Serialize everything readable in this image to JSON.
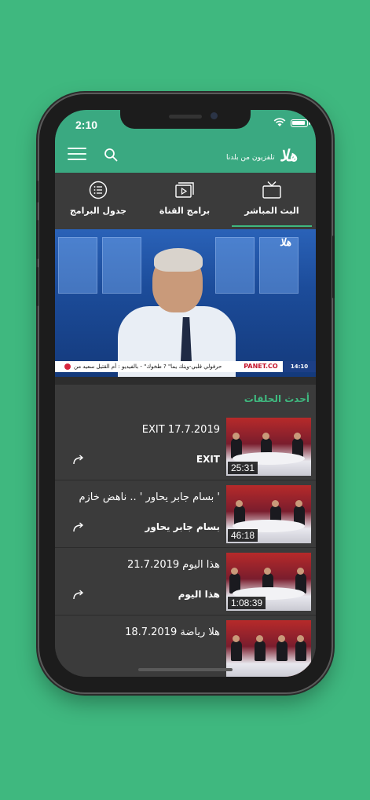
{
  "status": {
    "time": "2:10"
  },
  "header": {
    "tagline": "تلفزيون من بلدنا",
    "logo": "هلا"
  },
  "tabs": [
    {
      "label": "البث المباشر",
      "icon": "tv-icon",
      "active": true
    },
    {
      "label": "برامج القناة",
      "icon": "play-screen-icon",
      "active": false
    },
    {
      "label": "جدول البرامج",
      "icon": "list-circle-icon",
      "active": false
    }
  ],
  "video": {
    "watermark": "هلا",
    "ticker_text": "حرفولي قلبي-وينك يما\" ? طخوك\" - بالفيديو : أم القتيل سعيد من",
    "ticker_brand": "PANET.CO",
    "ticker_time": "14:10"
  },
  "section": {
    "title": "أحدث الحلقات"
  },
  "episodes": [
    {
      "title": "EXIT 17.7.2019",
      "show": "EXIT",
      "duration": "25:31"
    },
    {
      "title": "' بسام جابر يحاور ' .. ناهض خازم",
      "show": "بسام جابر يحاور",
      "duration": "46:18"
    },
    {
      "title": "هذا اليوم 21.7.2019",
      "show": "هذا اليوم",
      "duration": "1:08:39"
    },
    {
      "title": "هلا رياضة 18.7.2019",
      "show": "",
      "duration": ""
    }
  ],
  "colors": {
    "background": "#3fb87f",
    "accent": "#3aa981",
    "dark": "#3b3b3b"
  }
}
